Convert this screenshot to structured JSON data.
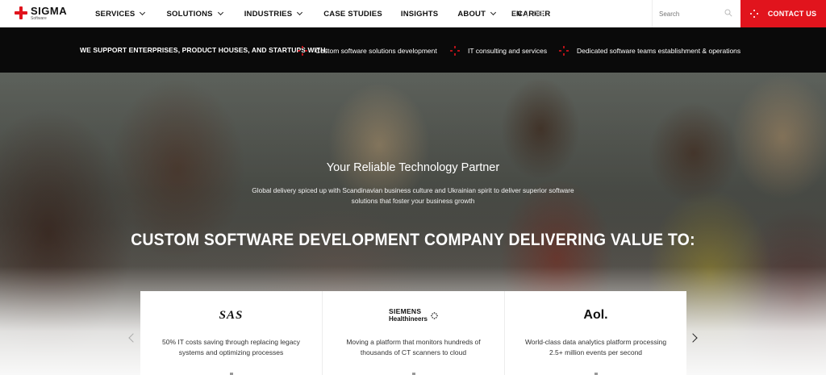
{
  "header": {
    "logo": {
      "name": "SIGMA",
      "sub": "Software"
    },
    "nav": [
      {
        "label": "SERVICES",
        "dropdown": true
      },
      {
        "label": "SOLUTIONS",
        "dropdown": true
      },
      {
        "label": "INDUSTRIES",
        "dropdown": true
      },
      {
        "label": "CASE STUDIES",
        "dropdown": false
      },
      {
        "label": "INSIGHTS",
        "dropdown": false
      },
      {
        "label": "ABOUT",
        "dropdown": true
      },
      {
        "label": "CAREER",
        "dropdown": false
      }
    ],
    "lang": {
      "active": "EN",
      "separator": "|",
      "other": "DE"
    },
    "search": {
      "placeholder": "Search"
    },
    "contact_label": "CONTACT US",
    "accent": "#e1141d"
  },
  "band": {
    "lead": "WE SUPPORT ENTERPRISES, PRODUCT HOUSES, AND STARTUPS WITH:",
    "items": [
      "Custom software solutions development",
      "IT consulting and services",
      "Dedicated software teams establishment & operations"
    ]
  },
  "hero": {
    "title": "Your Reliable Technology Partner",
    "subtitle": "Global delivery spiced up with Scandinavian business culture and Ukrainian spirit to deliver superior software solutions that foster your business growth",
    "heading": "CUSTOM SOFTWARE DEVELOPMENT COMPANY DELIVERING VALUE TO:"
  },
  "cards": [
    {
      "logo": "SAS",
      "description": "50% IT costs saving through replacing legacy systems and optimizing processes"
    },
    {
      "logo": "SIEMENS Healthineers",
      "logo_line1": "SIEMENS",
      "logo_line2": "Healthineers",
      "description": "Moving a platform that monitors hundreds of thousands of CT scanners to cloud"
    },
    {
      "logo": "Aol.",
      "description": "World-class data analytics platform processing 2.5+ million events per second"
    }
  ]
}
